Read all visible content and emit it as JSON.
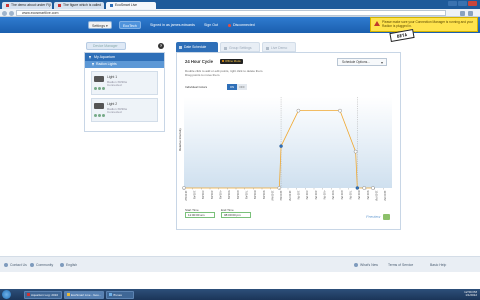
{
  "browser": {
    "tabs": [
      {
        "title": "The demo about under Fiji",
        "active": false
      },
      {
        "title": "The figure which is called",
        "active": false
      },
      {
        "title": "EcoSmart Live",
        "active": true
      }
    ],
    "url": "www.ecosmartlive.com"
  },
  "header": {
    "settings_label": "Settings",
    "ecotech_label": "EcoTech",
    "signed_in": "Signed in as james.edwards",
    "sign_out": "Sign Out",
    "status": "Disconnected"
  },
  "notification": {
    "text": "Please make sure your Connection Manager is running and your Radion is plugged in.",
    "beta": "BETA"
  },
  "sidebar": {
    "device_manager": "Device Manager",
    "aquarium": "My Aquarium",
    "group": "Radion Lights",
    "lights": [
      {
        "name": "Light 1",
        "model": "Radion XR30w",
        "status": "Connected"
      },
      {
        "name": "Light 2",
        "model": "Radion XR30w",
        "status": "Connected"
      }
    ]
  },
  "tabs": {
    "date_schedule": "Date Schedule",
    "group_settings": "Group Settings",
    "live_demo": "Live Demo"
  },
  "main": {
    "cycle_title": "24 Hour Cycle",
    "offline_mode": "Offline Mode",
    "schedule_options": "Schedule Options...",
    "instructions_1": "Double click to add or edit points, right click to delete them.",
    "instructions_2": "Drag points to move them.",
    "individual_colors": "Individual Colors",
    "toggle_on": "ON",
    "toggle_off": "OFF",
    "start_time_label": "Start Time",
    "start_time": "11:00:00 am",
    "end_time_label": "End Time",
    "end_time": "08:00:00 pm",
    "preview": "Preview"
  },
  "chart_data": {
    "type": "line",
    "ylabel": "Relative Intensity",
    "x_ticks": [
      "12:00 AM",
      "1:00 AM",
      "2:00 AM",
      "3:00 AM",
      "4:00 AM",
      "5:00 AM",
      "6:00 AM",
      "7:00 AM",
      "8:00 AM",
      "9:00 AM",
      "10:00 AM",
      "11:00 AM",
      "12:00 PM",
      "1:00 PM",
      "2:00 PM",
      "3:00 PM",
      "4:00 PM",
      "5:00 PM",
      "6:00 PM",
      "7:00 PM",
      "8:00 PM",
      "9:00 PM",
      "10:00 PM",
      "11:00 PM"
    ],
    "xlim": [
      0,
      24
    ],
    "ylim": [
      0,
      100
    ],
    "series": [
      {
        "color": "#f0a830",
        "x": [
          0,
          11,
          11.2,
          13.2,
          18,
          19.8,
          20,
          20.8,
          21.8
        ],
        "y": [
          0,
          0,
          46,
          85,
          85,
          40,
          0,
          0,
          0
        ]
      }
    ],
    "markers": {
      "gray_x": [
        0,
        11,
        13.2,
        18,
        19.8,
        20.8,
        21.8
      ],
      "selected_x": [
        11.2,
        20
      ]
    },
    "guide_x": [
      11.2,
      20
    ],
    "grid": false
  },
  "footer": {
    "links": [
      "Contact Us",
      "Community",
      "English",
      "What's New",
      "Terms of Service",
      "Basic Help"
    ]
  },
  "taskbar": {
    "items": [
      "Aquarium Log: 2010",
      "EcoSmart Live - Goo...",
      "iTunes"
    ],
    "time": "12:59 PM",
    "date": "1/1/2012"
  }
}
